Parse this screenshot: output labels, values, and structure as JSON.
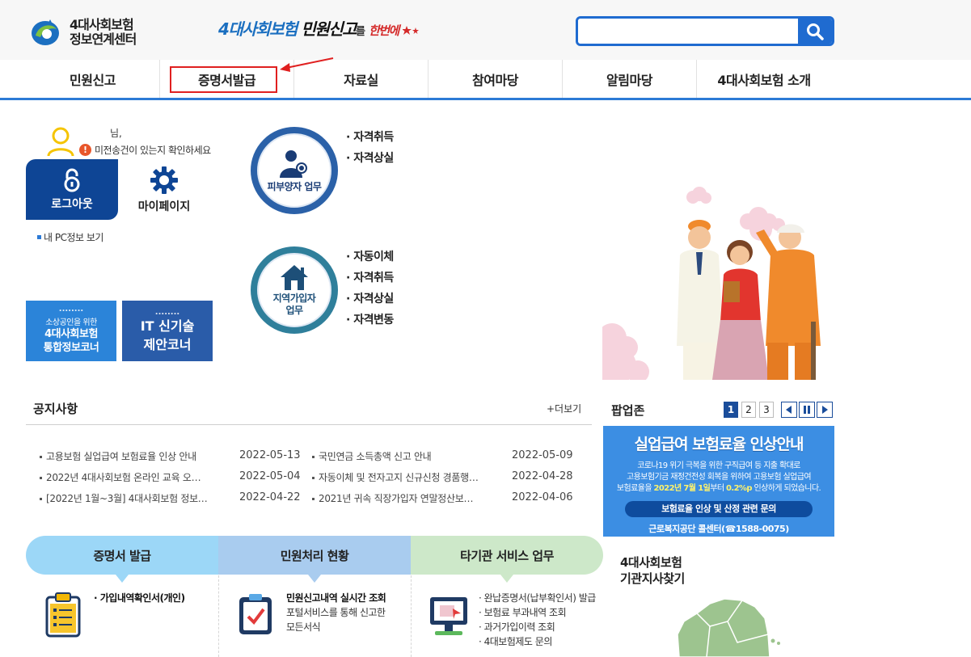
{
  "header": {
    "logo_line1": "4대사회보험",
    "logo_line2": "정보연계센터",
    "slogan_blue": "4대사회보험",
    "slogan_dark": "민원신고",
    "slogan_small": "를",
    "slogan_red": "한번에",
    "search_placeholder": ""
  },
  "nav": {
    "items": [
      "민원신고",
      "증명서발급",
      "자료실",
      "참여마당",
      "알림마당",
      "4대사회보험 소개"
    ]
  },
  "user": {
    "name": "님,",
    "notice": "미전송건이 있는지 확인하세요",
    "warn_glyph": "!",
    "logout": "로그아웃",
    "mypage": "마이페이지",
    "pcinfo": "내 PC정보 보기"
  },
  "banners": {
    "small_dots": "........",
    "small_sub": "소상공인을 위한",
    "small_line1": "4대사회보험",
    "small_line2": "통합정보코너",
    "it_dots": "........",
    "it_line1": "IT 신기술",
    "it_line2": "제안코너"
  },
  "work": {
    "dependent_label": "피부양자 업무",
    "dependent_tasks": [
      "· 자격취득",
      "· 자격상실"
    ],
    "regional_label1": "지역가입자",
    "regional_label2": "업무",
    "regional_tasks": [
      "· 자동이체",
      "· 자격취득",
      "· 자격상실",
      "· 자격변동"
    ]
  },
  "notice": {
    "title": "공지사항",
    "more": "+더보기",
    "left": [
      {
        "title": "고용보험 실업급여 보험료율 인상 안내",
        "date": "2022-05-13"
      },
      {
        "title": "2022년 4대사회보험 온라인 교육 오…",
        "date": "2022-05-04"
      },
      {
        "title": "[2022년 1월~3월] 4대사회보험 정보…",
        "date": "2022-04-22"
      }
    ],
    "right": [
      {
        "title": "국민연금 소득총액 신고 안내",
        "date": "2022-05-09"
      },
      {
        "title": "자동이체 및 전자고지 신규신청 경품행…",
        "date": "2022-04-28"
      },
      {
        "title": "2021년 귀속 직장가입자 연말정산보…",
        "date": "2022-04-06"
      }
    ]
  },
  "popup": {
    "title": "팝업존",
    "pages": [
      "1",
      "2",
      "3"
    ],
    "headline": "실업급여 보험료율 인상안내",
    "text1": "코로나19 위기 극복을 위한 구직급여 등 지출 확대로",
    "text2": "고용보험기금 재정건전성 회복을 위하여 고용보험 실업급여",
    "text3a": "보험료율을 ",
    "text3b": "2022년 7월 1일",
    "text3c": "부터 ",
    "text3d": "0.2%p",
    "text3e": " 인상하게 되었습니다.",
    "pill": "보험료율 인상 및 산정 관련 문의",
    "contact": "근로복지공단 콜센터(☎1588-0075)"
  },
  "tabs": {
    "cert": "증명서 발급",
    "status": "민원처리 현황",
    "other": "타기관 서비스 업무"
  },
  "services": {
    "cert_item": "· 가입내역확인서(개인)",
    "status_title": "민원신고내역 실시간 조회",
    "status_line1": "포털서비스를 통해 신고한",
    "status_line2": "모든서식",
    "other_items": [
      "· 완납증명서(납부확인서) 발급",
      "· 보험료 부과내역 조회",
      "· 과거가입이력 조회",
      "· 4대보험제도 문의"
    ]
  },
  "agency": {
    "line1": "4대사회보험",
    "line2": "기관지사찾기"
  },
  "colors": {
    "primary_blue": "#1f6bd0",
    "nav_highlight_red": "#e02020",
    "logout_bg": "#0e4595",
    "popup_bg": "#3c8ee3"
  }
}
